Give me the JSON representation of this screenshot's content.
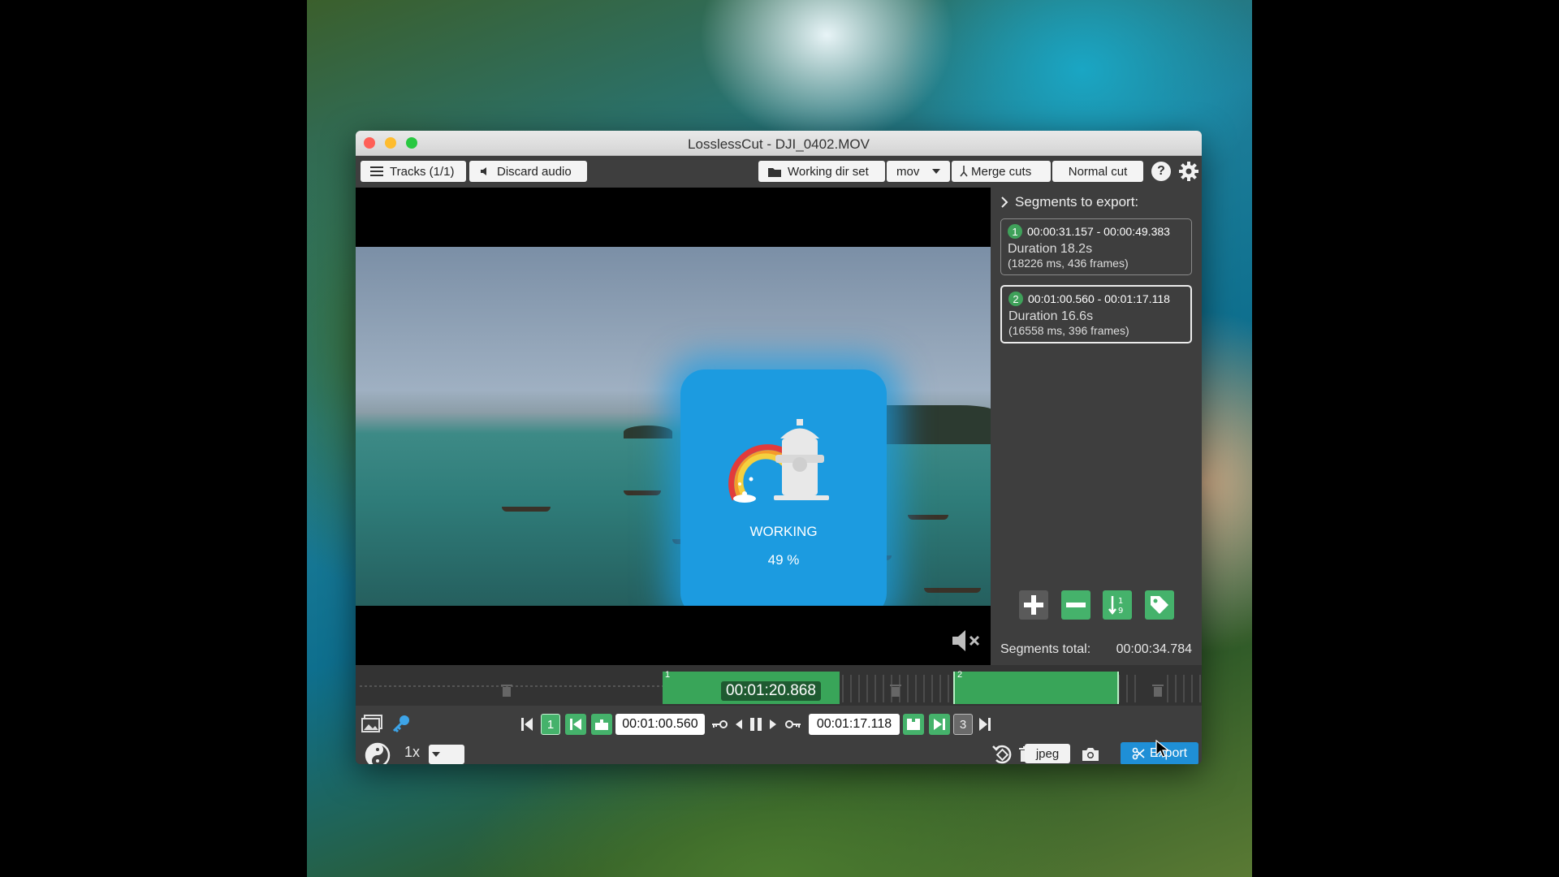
{
  "window": {
    "title": "LosslessCut - DJI_0402.MOV"
  },
  "toolbar": {
    "tracks_label": "Tracks (1/1)",
    "discard_audio_label": "Discard audio",
    "working_dir_label": "Working dir set",
    "format_value": "mov",
    "merge_cuts_label": "Merge cuts",
    "cut_mode_label": "Normal cut",
    "help_label": "?"
  },
  "progress": {
    "label": "WORKING",
    "percent_text": "49 %",
    "percent": 49
  },
  "segments": {
    "header": "Segments to export:",
    "items": [
      {
        "num": "1",
        "range": "00:00:31.157 - 00:00:49.383",
        "duration": "Duration 18.2s",
        "detail": "(18226 ms, 436 frames)"
      },
      {
        "num": "2",
        "range": "00:01:00.560 - 00:01:17.118",
        "duration": "Duration 16.6s",
        "detail": "(16558 ms, 396 frames)"
      }
    ],
    "total_label": "Segments total:",
    "total_value": "00:00:34.784"
  },
  "timeline": {
    "current_time": "00:01:20.868",
    "segment_labels": [
      "1",
      "2"
    ]
  },
  "controls": {
    "segment_start_num": "1",
    "segment_end_num": "3",
    "cut_start_time": "00:01:00.560",
    "cut_end_time": "00:01:17.118",
    "playback_rate": "1x",
    "capture_format": "jpeg",
    "export_label": "Export"
  },
  "colors": {
    "accent_green": "#45b26b",
    "accent_blue": "#1f8fd6",
    "working_blue": "#1c9be0"
  }
}
